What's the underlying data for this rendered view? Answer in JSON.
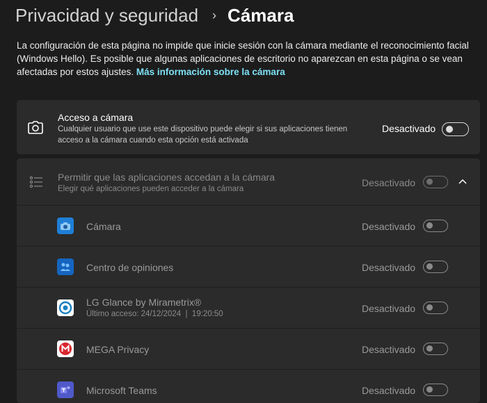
{
  "breadcrumb": {
    "parent": "Privacidad y seguridad",
    "separator": "›",
    "current": "Cámara"
  },
  "intro": {
    "text": "La configuración de esta página no impide que inicie sesión con la cámara mediante el reconocimiento facial (Windows Hello). Es posible que algunas aplicaciones de escritorio no aparezcan en esta página o se vean afectadas por estos ajustes.",
    "link": "Más información sobre la cámara"
  },
  "camera_access": {
    "icon": "camera-icon",
    "title": "Acceso a cámara",
    "subtitle": "Cualquier usuario que use este dispositivo puede elegir si sus aplicaciones tienen acceso a la cámara cuando esta opción está activada",
    "state": "Desactivado",
    "on": false
  },
  "apps_access": {
    "icon": "list-icon",
    "title": "Permitir que las aplicaciones accedan a la cámara",
    "subtitle": "Elegir qué aplicaciones pueden acceder a la cámara",
    "state": "Desactivado",
    "on": false,
    "expanded": true
  },
  "apps": [
    {
      "name": "Cámara",
      "subtitle": "",
      "state": "Desactivado",
      "icon": "camera-app-icon",
      "color": "#1f7fd6"
    },
    {
      "name": "Centro de opiniones",
      "subtitle": "",
      "state": "Desactivado",
      "icon": "feedback-hub-icon",
      "color": "#1565c0"
    },
    {
      "name": "LG Glance by Mirametrix®",
      "subtitle": "Último acceso: 24/12/2024  |  19:20:50",
      "state": "Desactivado",
      "icon": "lg-glance-icon",
      "color": "#ffffff"
    },
    {
      "name": "MEGA Privacy",
      "subtitle": "",
      "state": "Desactivado",
      "icon": "mega-icon",
      "color": "#d9272e"
    },
    {
      "name": "Microsoft Teams",
      "subtitle": "",
      "state": "Desactivado",
      "icon": "teams-icon",
      "color": "#5059c9"
    }
  ],
  "colors": {
    "background": "#1c1c1c",
    "card": "#2b2b2b",
    "link": "#7ee0f5"
  }
}
